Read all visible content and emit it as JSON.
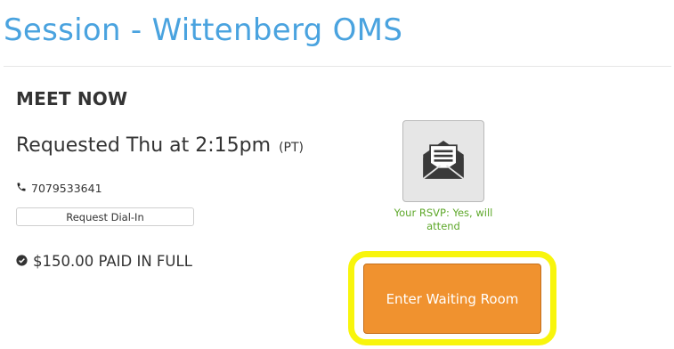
{
  "page": {
    "title": "Session - Wittenberg OMS"
  },
  "session": {
    "heading": "MEET NOW",
    "requested": "Requested Thu at 2:15pm",
    "timezone": "(PT)",
    "phone": "7079533641",
    "dial_in_label": "Request Dial-In",
    "payment_status": "$150.00 PAID IN FULL"
  },
  "rsvp": {
    "icon": "envelope-open-icon",
    "status_text": "Your RSVP: Yes, will attend"
  },
  "actions": {
    "enter_waiting_room_label": "Enter Waiting Room"
  },
  "colors": {
    "title": "#4aa3df",
    "rsvp_text": "#5ea82a",
    "primary_button": "#f0922f",
    "highlight": "#f8f50c"
  }
}
